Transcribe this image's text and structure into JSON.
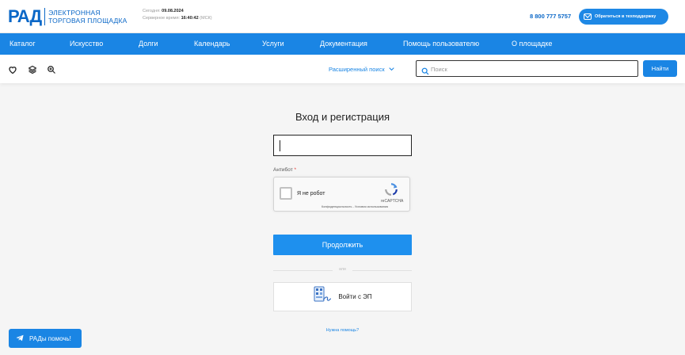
{
  "header": {
    "logo": "РАД",
    "logo_text_line1": "ЭЛЕКТРОННАЯ",
    "logo_text_line2": "ТОРГОВАЯ ПЛОЩАДКА",
    "today_label": "Сегодня:",
    "today_value": "09.08.2024",
    "server_time_label": "Серверное время:",
    "server_time_value": "16:40:42",
    "server_time_zone": "(МСК)",
    "phone": "8 800 777 5757",
    "support_label": "Обратиться в техподдержку"
  },
  "nav": {
    "items": [
      {
        "label": "Каталог"
      },
      {
        "label": "Искусство"
      },
      {
        "label": "Долги"
      },
      {
        "label": "Календарь"
      },
      {
        "label": "Услуги"
      },
      {
        "label": "Документация"
      },
      {
        "label": "Помощь пользователю"
      },
      {
        "label": "О площадке"
      }
    ]
  },
  "toolbar": {
    "advanced_search": "Расширенный поиск",
    "search_placeholder": "Поиск",
    "search_value": "",
    "find_label": "Найти",
    "icons": [
      "heart-icon",
      "layers-icon",
      "zoom-icon"
    ]
  },
  "login": {
    "title": "Вход и регистрация",
    "login_value": "",
    "antibot_label": "Антибот",
    "antibot_required": "*",
    "captcha_label": "Я не робот",
    "captcha_brand": "reCAPTCHA",
    "captcha_terms": "Конфиденциальность - Условия использования",
    "captcha_checked": false,
    "continue_label": "Продолжить",
    "or_text": "или",
    "ep_label": "Войти с ЭП",
    "help_link": "Нужна помощь?"
  },
  "help_widget": {
    "label": "РАДы помочь!"
  },
  "colors": {
    "brand": "#0a67c7",
    "accent": "#1a85e4",
    "background": "#f5f5f5"
  }
}
